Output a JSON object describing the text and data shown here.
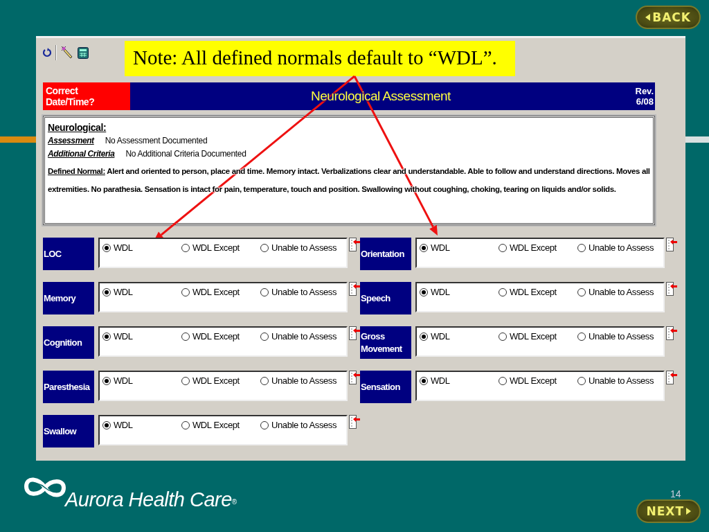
{
  "nav": {
    "back": "BACK",
    "next": "NEXT"
  },
  "note": "Note: All defined normals default to “WDL”.",
  "header": {
    "date_button": "Correct Date/Time?",
    "title": "Neurological Assessment",
    "revision": "Rev. 6/08"
  },
  "summary": {
    "heading": "Neurological:",
    "entries": [
      {
        "kind": "entry",
        "label": "Assessment",
        "text": "No Assessment Documented"
      },
      {
        "kind": "entry",
        "label": "Additional Criteria",
        "text": "No Additional Criteria Documented"
      },
      {
        "kind": "definition",
        "label": "Defined Normal:",
        "text": "Alert and oriented to person, place and time. Memory intact. Verbalizations clear and understandable. Able to follow and understand directions.  Moves all extremities. No parathesia. Sensation is intact for pain, temperature, touch and position. Swallowing without coughing, choking, tearing on liquids and/or solids."
      }
    ]
  },
  "left_column": [
    {
      "label": "LOC",
      "options": [
        {
          "label": "WDL",
          "selected": true
        },
        {
          "label": "WDL Except",
          "selected": false
        },
        {
          "label": "Unable to Assess",
          "selected": false
        }
      ]
    },
    {
      "label": "Memory",
      "options": [
        {
          "label": "WDL",
          "selected": true
        },
        {
          "label": "WDL Except",
          "selected": false
        },
        {
          "label": "Unable to Assess",
          "selected": false
        }
      ]
    },
    {
      "label": "Cognition",
      "options": [
        {
          "label": "WDL",
          "selected": true
        },
        {
          "label": "WDL Except",
          "selected": false
        },
        {
          "label": "Unable to Assess",
          "selected": false
        }
      ]
    },
    {
      "label": "Paresthesia",
      "options": [
        {
          "label": "WDL",
          "selected": true
        },
        {
          "label": "WDL Except",
          "selected": false
        },
        {
          "label": "Unable to Assess",
          "selected": false
        }
      ]
    },
    {
      "label": "Swallow",
      "options": [
        {
          "label": "WDL",
          "selected": true
        },
        {
          "label": "WDL Except",
          "selected": false
        },
        {
          "label": "Unable to Assess",
          "selected": false
        }
      ]
    }
  ],
  "right_column": [
    {
      "label": "Orientation",
      "options": [
        {
          "label": "WDL",
          "selected": true
        },
        {
          "label": "WDL Except",
          "selected": false
        },
        {
          "label": "Unable to Assess",
          "selected": false
        }
      ]
    },
    {
      "label": "Speech",
      "options": [
        {
          "label": "WDL",
          "selected": true
        },
        {
          "label": "WDL Except",
          "selected": false
        },
        {
          "label": "Unable to Assess",
          "selected": false
        }
      ]
    },
    {
      "label": "Gross Movement",
      "options": [
        {
          "label": "WDL",
          "selected": true
        },
        {
          "label": "WDL Except",
          "selected": false
        },
        {
          "label": "Unable to Assess",
          "selected": false
        }
      ]
    },
    {
      "label": "Sensation",
      "options": [
        {
          "label": "WDL",
          "selected": true
        },
        {
          "label": "WDL Except",
          "selected": false
        },
        {
          "label": "Unable to Assess",
          "selected": false
        }
      ]
    }
  ],
  "footer": {
    "brand": "Aurora Health Care",
    "registered": "®",
    "page_number": "14"
  }
}
